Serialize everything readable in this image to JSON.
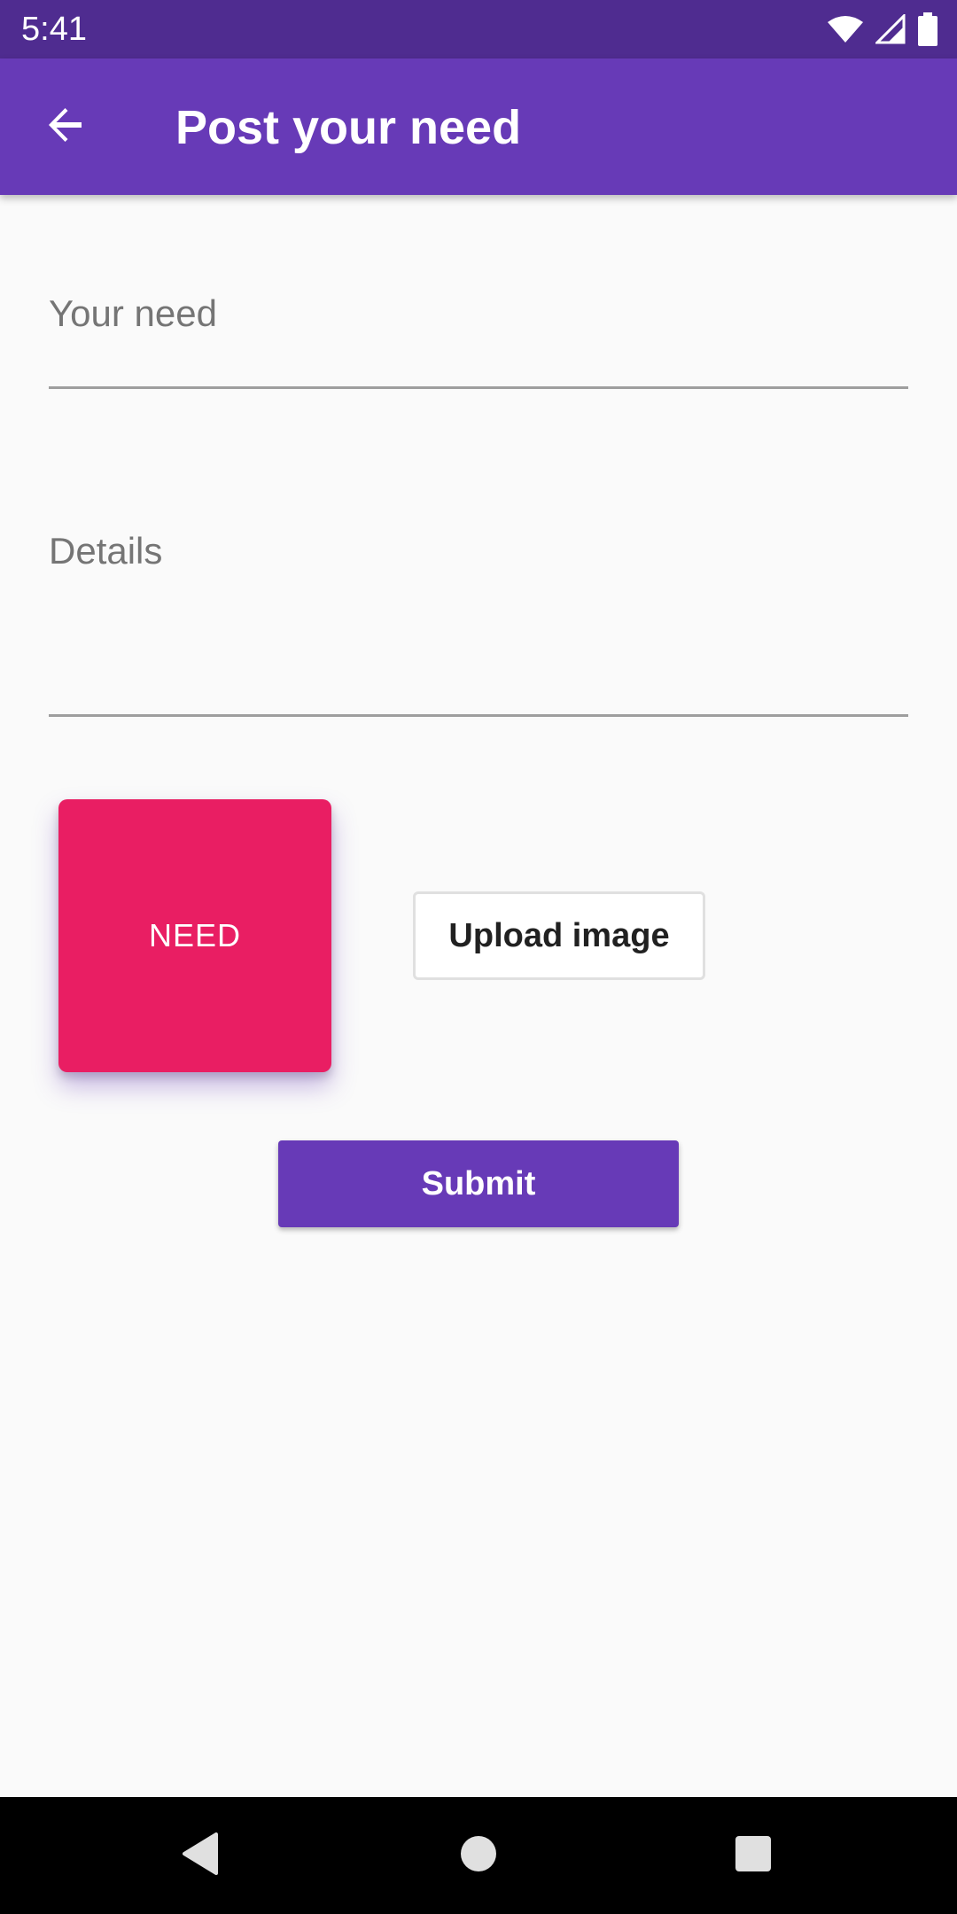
{
  "status_bar": {
    "time": "5:41",
    "icons": [
      "wifi-icon",
      "signal-icon",
      "battery-icon"
    ]
  },
  "app_bar": {
    "title": "Post your need",
    "back_icon": "arrow-back-icon"
  },
  "form": {
    "need_placeholder": "Your need",
    "details_placeholder": "Details"
  },
  "need_image": {
    "label": "NEED"
  },
  "upload_button": {
    "label": "Upload image"
  },
  "submit_button": {
    "label": "Submit"
  },
  "nav_bar": {
    "icons": [
      "back-triangle-icon",
      "home-circle-icon",
      "recents-square-icon"
    ]
  },
  "colors": {
    "status_bar": "#4f2c90",
    "primary": "#673ab7",
    "accent": "#e91e63",
    "background": "#fafafa"
  }
}
